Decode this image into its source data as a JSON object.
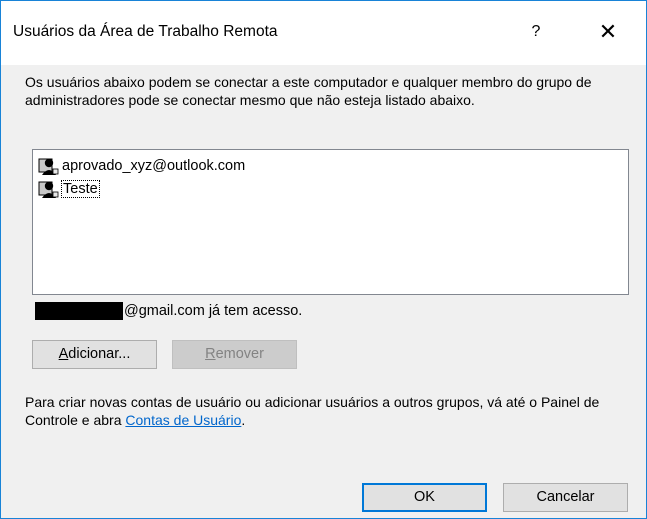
{
  "window": {
    "title": "Usuários da Área de Trabalho Remota",
    "help_glyph": "?",
    "close_glyph": "✕"
  },
  "description": "Os usuários abaixo podem se conectar a este computador e qualquer membro do grupo de administradores pode se conectar mesmo que não esteja listado abaixo.",
  "users": [
    {
      "name": "aprovado_xyz@outlook.com",
      "icon": "user-icon"
    },
    {
      "name": "Teste",
      "icon": "user-icon"
    }
  ],
  "access_note": "@gmail.com já tem acesso.",
  "buttons": {
    "add": {
      "label_underlined": "A",
      "label_rest": "dicionar...",
      "enabled": true
    },
    "remove": {
      "label_underlined": "R",
      "label_rest": "emover",
      "enabled": false
    },
    "ok": "OK",
    "cancel": "Cancelar"
  },
  "info": {
    "text": "Para criar novas contas de usuário ou adicionar usuários a outros grupos, vá até o Painel de Controle e abra ",
    "link": "Contas de Usuário",
    "suffix": "."
  },
  "colors": {
    "accent": "#0078d7",
    "link": "#0066cc",
    "border": "#1883d7"
  }
}
